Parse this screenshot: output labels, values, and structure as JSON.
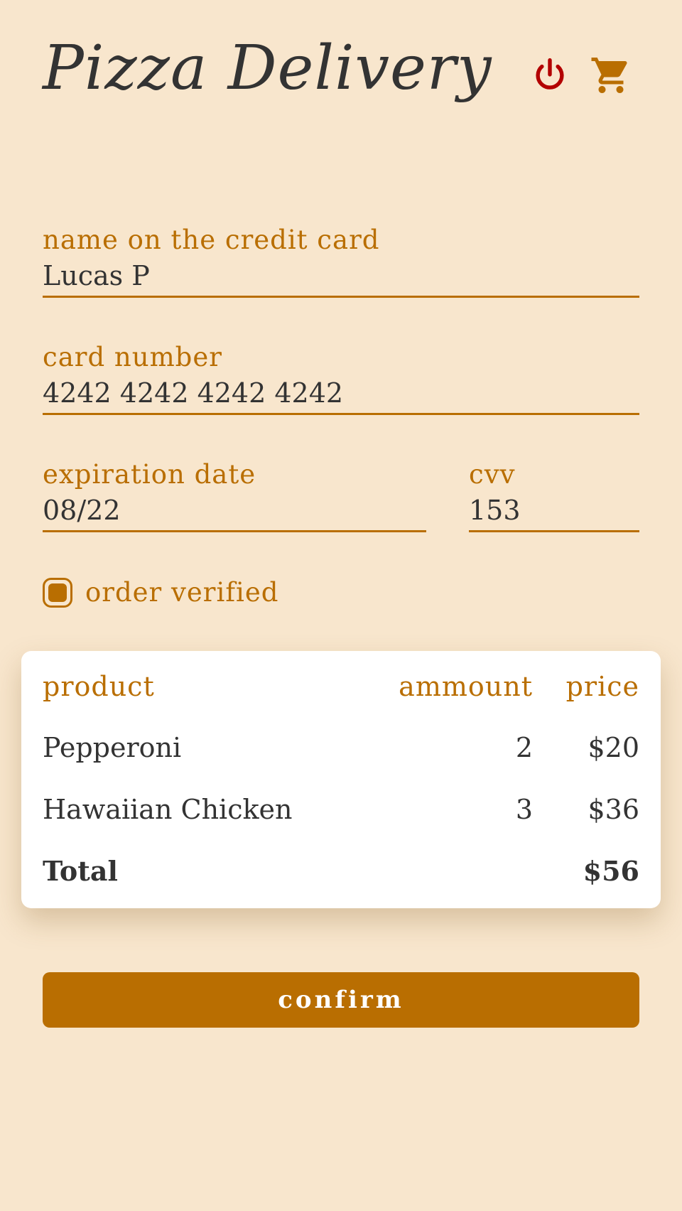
{
  "header": {
    "title": "Pizza Delivery",
    "power_icon": "power-icon",
    "cart_icon": "cart-icon"
  },
  "form": {
    "name_label": "name on the credit card",
    "name_value": "Lucas P",
    "card_label": "card number",
    "card_value": "4242 4242 4242 4242",
    "exp_label": "expiration date",
    "exp_value": "08/22",
    "cvv_label": "cvv",
    "cvv_value": "153",
    "verified_label": "order verified",
    "verified_checked": true
  },
  "order": {
    "headers": {
      "product": "product",
      "amount": "ammount",
      "price": "price"
    },
    "items": [
      {
        "product": "Pepperoni",
        "amount": "2",
        "price": "$20"
      },
      {
        "product": "Hawaiian Chicken",
        "amount": "3",
        "price": "$36"
      }
    ],
    "total_label": "Total",
    "total_value": "$56"
  },
  "actions": {
    "confirm_label": "confirm"
  },
  "colors": {
    "background": "#f8e6cd",
    "accent": "#b96e01",
    "power": "#b30000",
    "text": "#333333"
  }
}
